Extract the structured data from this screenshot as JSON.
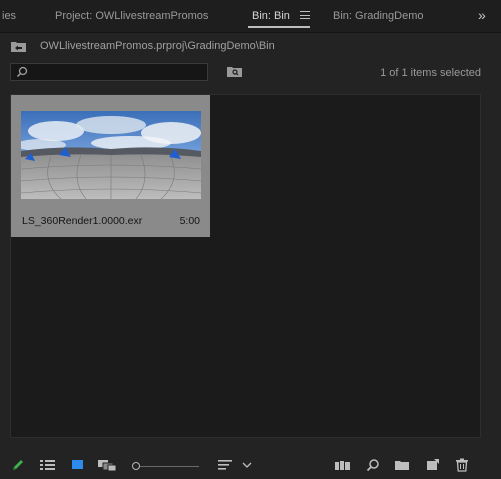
{
  "tabs": {
    "partial_left": "ies",
    "project": "Project: OWLlivestreamPromos",
    "bin_active": "Bin: Bin",
    "bin_grading": "Bin: GradingDemo",
    "overflow": "»"
  },
  "path": {
    "text": "OWLlivestreamPromos.prproj\\GradingDemo\\Bin"
  },
  "search": {
    "value": "",
    "placeholder": ""
  },
  "status": {
    "items_selected": "1 of 1 items selected"
  },
  "clip": {
    "name": "LS_360Render1.0000.exr",
    "duration": "5:00"
  },
  "zoom": {
    "level": 0.05
  },
  "colors": {
    "accent_blue": "#2d8ceb",
    "pencil_green": "#3fb24f",
    "clip_bg": "#8a8a8a"
  },
  "icons": {
    "write_on": "pencil-icon",
    "list_view": "list-view-icon",
    "icon_view": "icon-view-icon",
    "freeform_view": "freeform-view-icon",
    "sort": "sort-icons-icon",
    "automate": "automate-to-sequence-icon",
    "find": "find-icon",
    "new_bin": "new-bin-icon",
    "new_item": "new-item-icon",
    "clear": "trash-icon"
  }
}
